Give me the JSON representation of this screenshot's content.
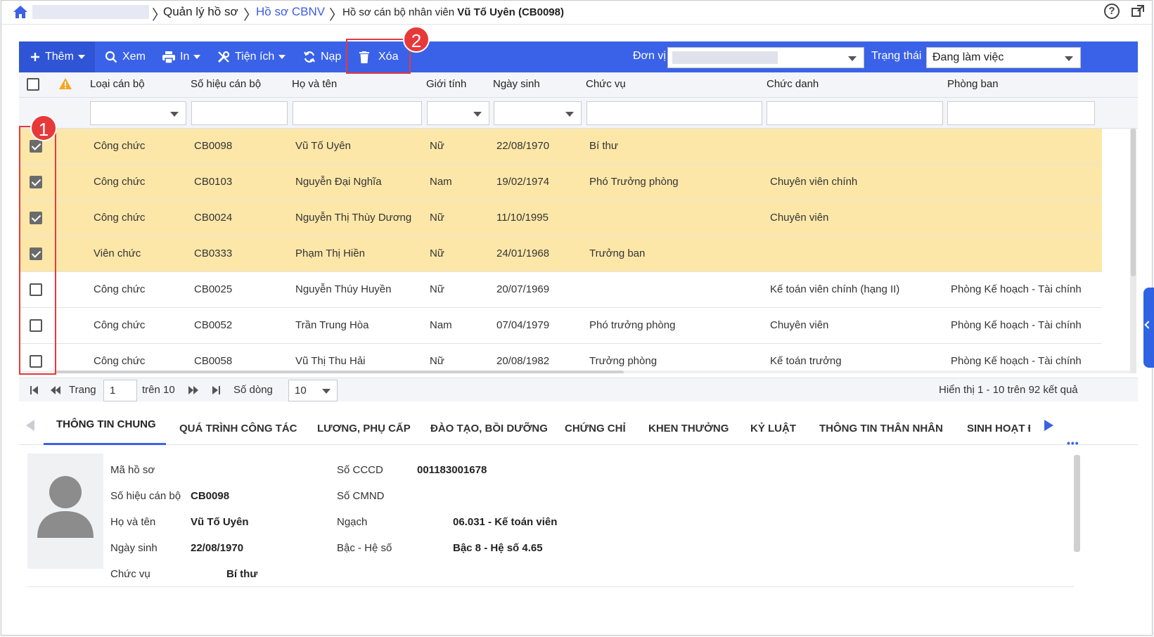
{
  "breadcrumb": {
    "section": "Quản lý hồ sơ",
    "link": "Hồ sơ CBNV",
    "current_prefix": "Hồ sơ cán bộ nhân viên",
    "current_name": "Vũ Tố Uyên (CB0098)"
  },
  "icons": {
    "home": "home-icon",
    "help": "help-icon",
    "external": "external-link-icon",
    "warning": "warning-icon"
  },
  "help_glyph": "?",
  "toolbar": {
    "add": "Thêm",
    "view": "Xem",
    "print": "In",
    "utilities": "Tiện ích",
    "reload": "Nạp",
    "delete": "Xóa",
    "unit_label": "Đơn vị",
    "status_label": "Trạng thái",
    "status_value": "Đang làm việc",
    "color": "#3a62e8"
  },
  "table": {
    "columns": [
      "Loại cán bộ",
      "Số hiệu cán bộ",
      "Họ và tên",
      "Giới tính",
      "Ngày sinh",
      "Chức vụ",
      "Chức danh",
      "Phòng ban"
    ],
    "rows": [
      {
        "checked": true,
        "type": "Công chức",
        "code": "CB0098",
        "name": "Vũ Tố Uyên",
        "gender": "Nữ",
        "dob": "22/08/1970",
        "position": "Bí thư",
        "title": "",
        "dept": ""
      },
      {
        "checked": true,
        "type": "Công chức",
        "code": "CB0103",
        "name": "Nguyễn Đại Nghĩa",
        "gender": "Nam",
        "dob": "19/02/1974",
        "position": "Phó Trưởng phòng",
        "title": "Chuyên viên chính",
        "dept": ""
      },
      {
        "checked": true,
        "type": "Công chức",
        "code": "CB0024",
        "name": "Nguyễn Thị Thùy Dương",
        "gender": "Nữ",
        "dob": "11/10/1995",
        "position": "",
        "title": "Chuyên viên",
        "dept": ""
      },
      {
        "checked": true,
        "type": "Viên chức",
        "code": "CB0333",
        "name": "Phạm Thị Hiền",
        "gender": "Nữ",
        "dob": "24/01/1968",
        "position": "Trưởng ban",
        "title": "",
        "dept": ""
      },
      {
        "checked": false,
        "type": "Công chức",
        "code": "CB0025",
        "name": "Nguyễn Thúy Huyền",
        "gender": "Nữ",
        "dob": "20/07/1969",
        "position": "",
        "title": "Kế toán viên chính (hạng II)",
        "dept": "Phòng Kế hoạch - Tài chính"
      },
      {
        "checked": false,
        "type": "Công chức",
        "code": "CB0052",
        "name": "Trần Trung Hòa",
        "gender": "Nam",
        "dob": "07/04/1979",
        "position": "Phó trưởng phòng",
        "title": "Chuyên viên",
        "dept": "Phòng Kế hoạch - Tài chính"
      },
      {
        "checked": false,
        "type": "Công chức",
        "code": "CB0058",
        "name": "Vũ Thị Thu Hải",
        "gender": "Nữ",
        "dob": "20/08/1982",
        "position": "Trưởng phòng",
        "title": "Kế toán trưởng",
        "dept": "Phòng Kế hoạch - Tài chính"
      }
    ],
    "selected_row_color": "#fde7a8"
  },
  "pager": {
    "page_label": "Trang",
    "page": "1",
    "of_label": "trên 10",
    "rows_label": "Số dòng",
    "rows_value": "10",
    "summary": "Hiển thị 1 - 10 trên 92 kết quả"
  },
  "tabs": [
    "THÔNG TIN CHUNG",
    "QUÁ TRÌNH CÔNG TÁC",
    "LƯƠNG, PHỤ CẤP",
    "ĐÀO TẠO, BỒI DƯỠNG",
    "CHỨNG CHỈ",
    "KHEN THƯỞNG",
    "KỶ LUẬT",
    "THÔNG TIN THÂN NHÂN",
    "SINH HOẠT Đ"
  ],
  "detail": {
    "ma_ho_so_label": "Mã hồ sơ",
    "ma_ho_so": "",
    "so_hieu_label": "Số hiệu cán bộ",
    "so_hieu": "CB0098",
    "ho_ten_label": "Họ và tên",
    "ho_ten": "Vũ Tố Uyên",
    "ngay_sinh_label": "Ngày sinh",
    "ngay_sinh": "22/08/1970",
    "chuc_vu_label": "Chức vụ",
    "chuc_vu": "Bí thư",
    "cccd_label": "Số CCCD",
    "cccd": "001183001678",
    "cmnd_label": "Số CMND",
    "cmnd": "",
    "ngach_label": "Ngạch",
    "ngach": "06.031 - Kế toán viên",
    "bac_label": "Bậc - Hệ số",
    "bac": "Bậc 8 - Hệ số 4.65"
  },
  "annotations": {
    "badge_1": "1",
    "badge_2": "2",
    "color": "#e8393a"
  }
}
